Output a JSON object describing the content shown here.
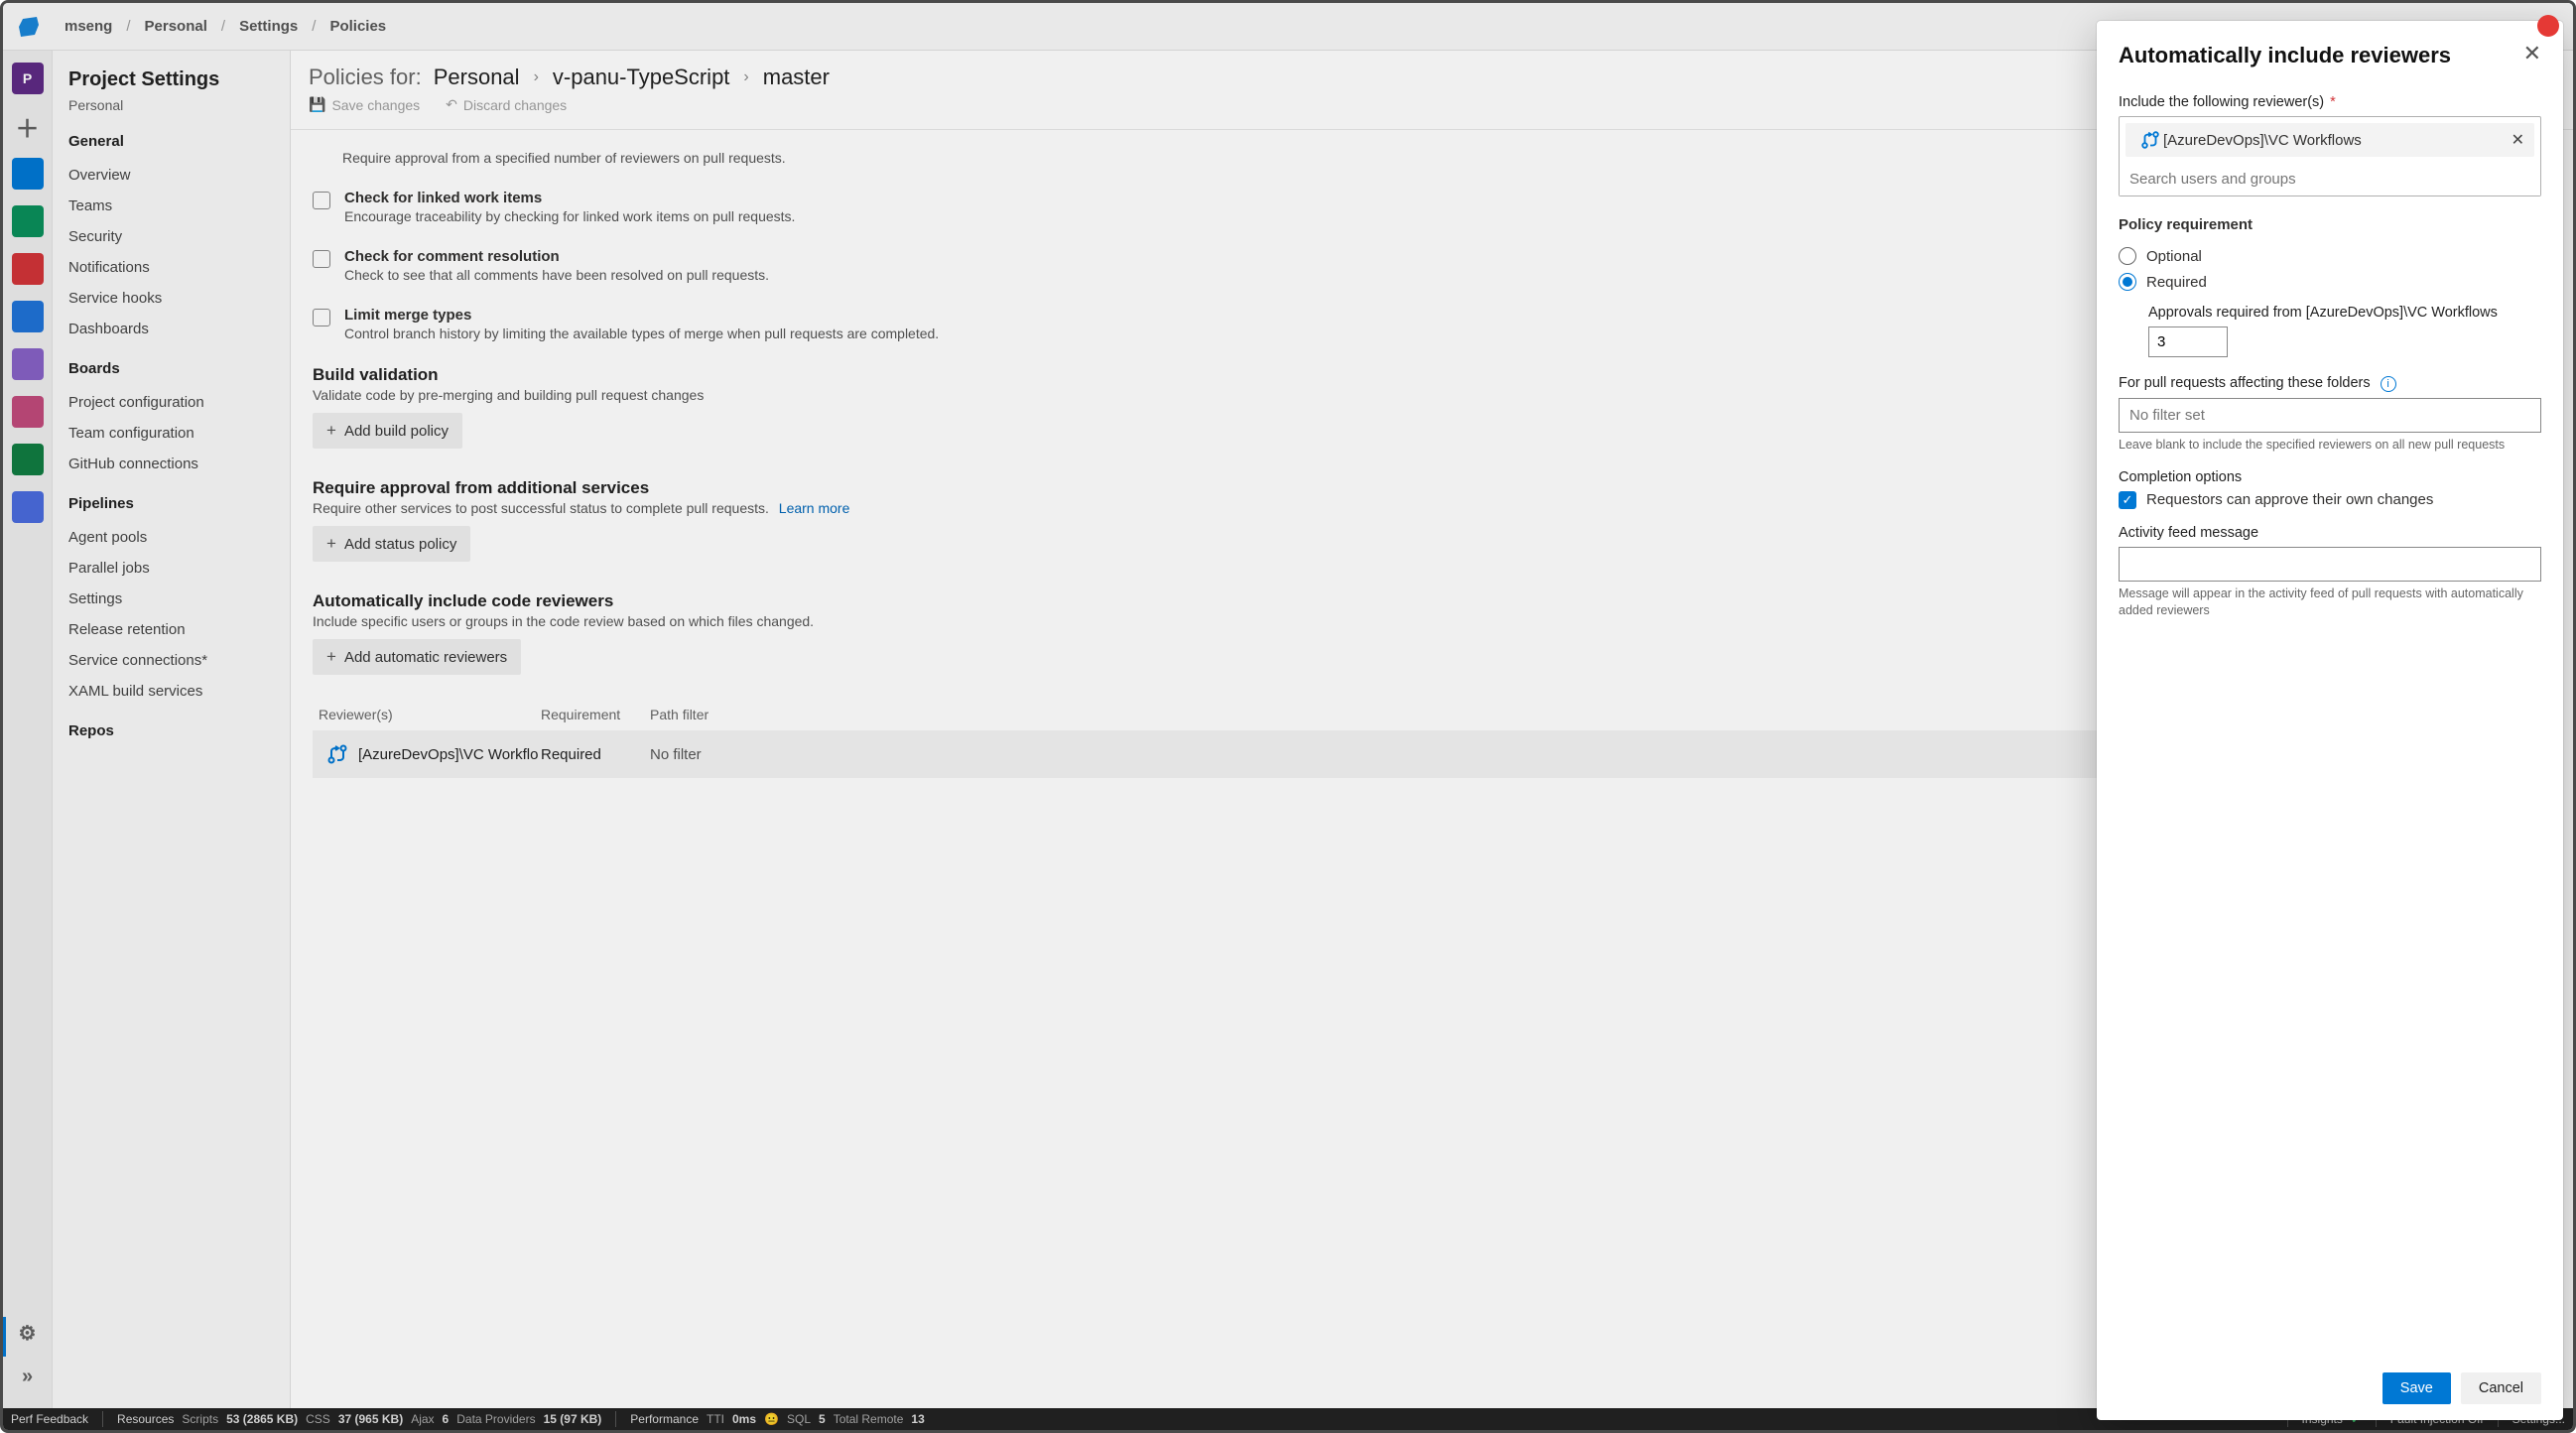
{
  "breadcrumb": {
    "org": "mseng",
    "proj": "Personal",
    "sect": "Settings",
    "page": "Policies"
  },
  "leftrail": {
    "items": [
      {
        "letter": "P",
        "bg": "#5e2a84"
      },
      {
        "letter": "",
        "bg": "#0078d4"
      },
      {
        "letter": "",
        "bg": "#0a8f5b"
      },
      {
        "letter": "",
        "bg": "#d13438"
      },
      {
        "letter": "",
        "bg": "#1f72d6"
      },
      {
        "letter": "",
        "bg": "#8661c5"
      },
      {
        "letter": "",
        "bg": "#c04a7b"
      },
      {
        "letter": "",
        "bg": "#107c41"
      },
      {
        "letter": "",
        "bg": "#4a6bdc"
      }
    ]
  },
  "settings": {
    "title": "Project Settings",
    "subtitle": "Personal",
    "groups": [
      {
        "header": "General",
        "items": [
          "Overview",
          "Teams",
          "Security",
          "Notifications",
          "Service hooks",
          "Dashboards"
        ]
      },
      {
        "header": "Boards",
        "items": [
          "Project configuration",
          "Team configuration",
          "GitHub connections"
        ]
      },
      {
        "header": "Pipelines",
        "items": [
          "Agent pools",
          "Parallel jobs",
          "Settings",
          "Release retention",
          "Service connections*",
          "XAML build services"
        ]
      },
      {
        "header": "Repos",
        "items": []
      }
    ]
  },
  "main": {
    "titleLabel": "Policies for:",
    "crumb1": "Personal",
    "crumb2": "v-panu-TypeScript",
    "crumb3": "master",
    "save": "Save changes",
    "discard": "Discard changes",
    "truncLine": "Require approval from a specified number of reviewers on pull requests.",
    "checks": [
      {
        "t": "Check for linked work items",
        "d": "Encourage traceability by checking for linked work items on pull requests."
      },
      {
        "t": "Check for comment resolution",
        "d": "Check to see that all comments have been resolved on pull requests."
      },
      {
        "t": "Limit merge types",
        "d": "Control branch history by limiting the available types of merge when pull requests are completed."
      }
    ],
    "buildValidation": {
      "hdr": "Build validation",
      "desc": "Validate code by pre-merging and building pull request changes",
      "btn": "Add build policy"
    },
    "additional": {
      "hdr": "Require approval from additional services",
      "desc": "Require other services to post successful status to complete pull requests.",
      "learn": "Learn more",
      "btn": "Add status policy"
    },
    "autoRev": {
      "hdr": "Automatically include code reviewers",
      "desc": "Include specific users or groups in the code review based on which files changed.",
      "btn": "Add automatic reviewers"
    },
    "table": {
      "c1": "Reviewer(s)",
      "c2": "Requirement",
      "c3": "Path filter",
      "row": {
        "rev": "[AzureDevOps]\\VC Workflo",
        "req": "Required",
        "pf": "No filter"
      }
    }
  },
  "flyout": {
    "title": "Automatically include reviewers",
    "includeLabel": "Include the following reviewer(s)",
    "reviewerPill": "[AzureDevOps]\\VC Workflows",
    "searchPlaceholder": "Search users and groups",
    "policyReqHdr": "Policy requirement",
    "optional": "Optional",
    "required": "Required",
    "approvalsLabel": "Approvals required from [AzureDevOps]\\VC Workflows",
    "approvalsValue": "3",
    "foldersLabel": "For pull requests affecting these folders",
    "foldersPlaceholder": "No filter set",
    "foldersHint": "Leave blank to include the specified reviewers on all new pull requests",
    "completionHdr": "Completion options",
    "ownChanges": "Requestors can approve their own changes",
    "activityLabel": "Activity feed message",
    "activityHint": "Message will appear in the activity feed of pull requests with automatically added reviewers",
    "save": "Save",
    "cancel": "Cancel"
  },
  "statusbar": {
    "perfFeedback": "Perf Feedback",
    "resources": "Resources",
    "scripts": "Scripts",
    "scriptsVal": "53 (2865 KB)",
    "css": "CSS",
    "cssVal": "37 (965 KB)",
    "ajax": "Ajax",
    "ajaxVal": "6",
    "dp": "Data Providers",
    "dpVal": "15 (97 KB)",
    "performance": "Performance",
    "tti": "TTI",
    "ttiVal": "0ms",
    "sql": "SQL",
    "sqlVal": "5",
    "totalRemote": "Total Remote",
    "totalRemoteVal": "13",
    "insights": "Insights",
    "fault": "Fault Injection Off",
    "settings": "Settings..."
  }
}
